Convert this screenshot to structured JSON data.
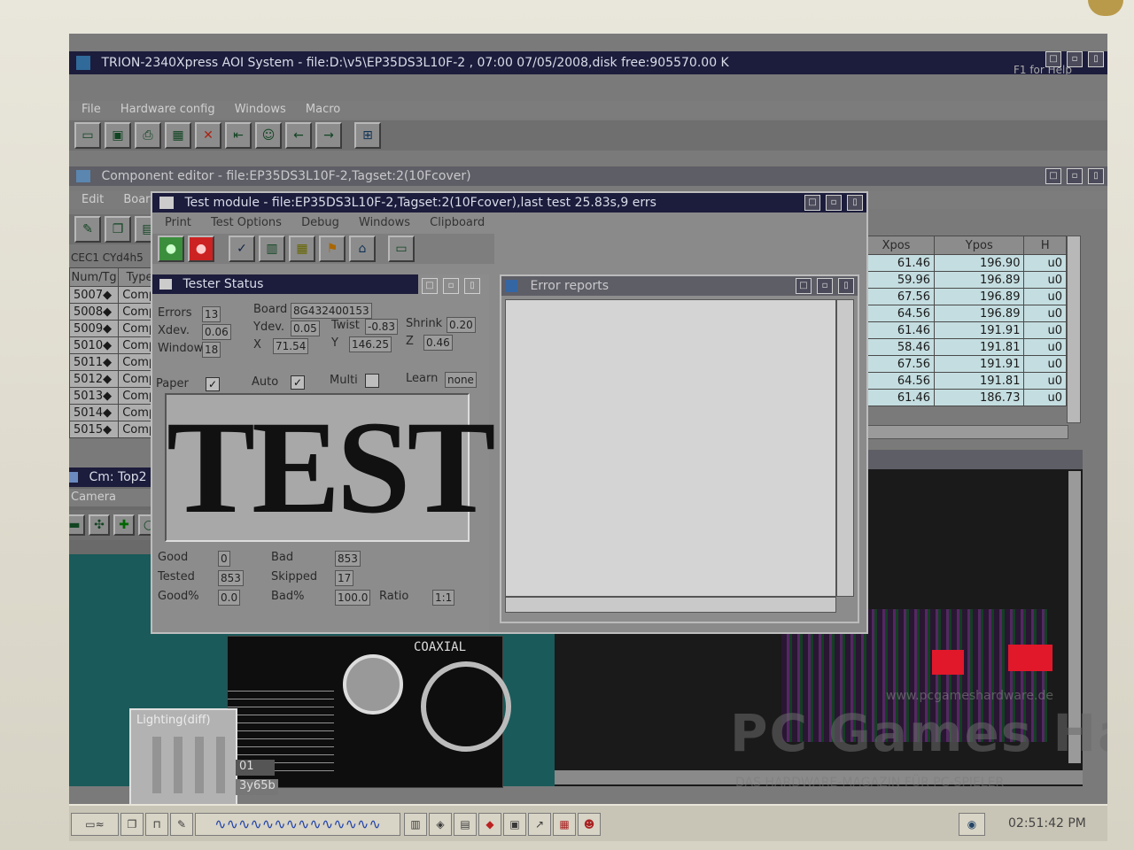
{
  "main_window": {
    "title": "TRION-2340Xpress AOI System - file:D:\\v5\\EP35DS3L10F-2 , 07:00 07/05/2008,disk free:905570.00 K",
    "help": "F1 for Help",
    "menu": [
      "File",
      "Hardware config",
      "Windows",
      "Macro"
    ]
  },
  "component_editor": {
    "title": "Component editor - file:EP35DS3L10F-2,Tagset:2(10Fcover)",
    "menu": [
      "Edit",
      "Board config"
    ],
    "grid_caption": "CEC1  CYd4h5",
    "left_headers": [
      "Num/Tg",
      "Type"
    ],
    "left_rows": [
      {
        "num": "5007◆",
        "type": "Comp"
      },
      {
        "num": "5008◆",
        "type": "Comp"
      },
      {
        "num": "5009◆",
        "type": "Comp"
      },
      {
        "num": "5010◆",
        "type": "Comp"
      },
      {
        "num": "5011◆",
        "type": "Comp"
      },
      {
        "num": "5012◆",
        "type": "Comp"
      },
      {
        "num": "5013◆",
        "type": "Comp"
      },
      {
        "num": "5014◆",
        "type": "Comp"
      },
      {
        "num": "5015◆",
        "type": "Comp"
      }
    ],
    "right_headers": [
      "Xpos",
      "Ypos",
      "H"
    ],
    "right_rows": [
      {
        "x": "61.46",
        "y": "196.90",
        "h": "u0"
      },
      {
        "x": "59.96",
        "y": "196.89",
        "h": "u0"
      },
      {
        "x": "67.56",
        "y": "196.89",
        "h": "u0"
      },
      {
        "x": "64.56",
        "y": "196.89",
        "h": "u0"
      },
      {
        "x": "61.46",
        "y": "191.91",
        "h": "u0"
      },
      {
        "x": "58.46",
        "y": "191.81",
        "h": "u0"
      },
      {
        "x": "67.56",
        "y": "191.91",
        "h": "u0"
      },
      {
        "x": "64.56",
        "y": "191.81",
        "h": "u0"
      },
      {
        "x": "61.46",
        "y": "186.73",
        "h": "u0"
      }
    ]
  },
  "test_module": {
    "title": "Test module - file:EP35DS3L10F-2,Tagset:2(10Fcover),last test 25.83s,9 errs",
    "menu": [
      "Print",
      "Test Options",
      "Debug",
      "Windows",
      "Clipboard"
    ]
  },
  "tester_status": {
    "title": "Tester Status",
    "errors_label": "Errors",
    "errors": "13",
    "board_label": "Board",
    "board": "8G432400153",
    "xdev_label": "Xdev.",
    "xdev": "0.06",
    "ydev_label": "Ydev.",
    "ydev": "0.05",
    "twist_label": "Twist",
    "twist": "-0.83",
    "shrink_label": "Shrink",
    "shrink": "0.20",
    "window_label": "Window",
    "window": "18",
    "x_label": "X",
    "x": "71.54",
    "y_label": "Y",
    "y": "146.25",
    "z_label": "Z",
    "z": "0.46",
    "paper_label": "Paper",
    "auto_label": "Auto",
    "multi_label": "Multi",
    "learn_label": "Learn",
    "learn_value": "none",
    "banner": "TEST",
    "good_label": "Good",
    "good": "0",
    "bad_label": "Bad",
    "bad": "853",
    "tested_label": "Tested",
    "tested": "853",
    "skipped_label": "Skipped",
    "skipped": "17",
    "goodpct_label": "Good%",
    "goodpct": "0.0",
    "badpct_label": "Bad%",
    "badpct": "100.0",
    "ratio_label": "Ratio",
    "ratio": "1:1"
  },
  "error_reports": {
    "title": "Error reports"
  },
  "cm_window": {
    "title": "Cm: Top2",
    "menu": [
      "Camera"
    ],
    "lighting": "Lighting(diff)",
    "readout1": "01",
    "readout2": "3y65b",
    "silkscreen": "COAXIAL"
  },
  "watermark": {
    "brand": "PC Games Hardware",
    "url": "www.pcgameshardware.de",
    "tagline": "DAS HARDWARE-MAGAZIN FÜR PC-SPIELER"
  },
  "taskbar": {
    "clock": "02:51:42 PM"
  },
  "colors": {
    "title_active": "#1c1c3c",
    "grid_cell": "#c4dde0",
    "desktop": "#7a7a7a"
  }
}
